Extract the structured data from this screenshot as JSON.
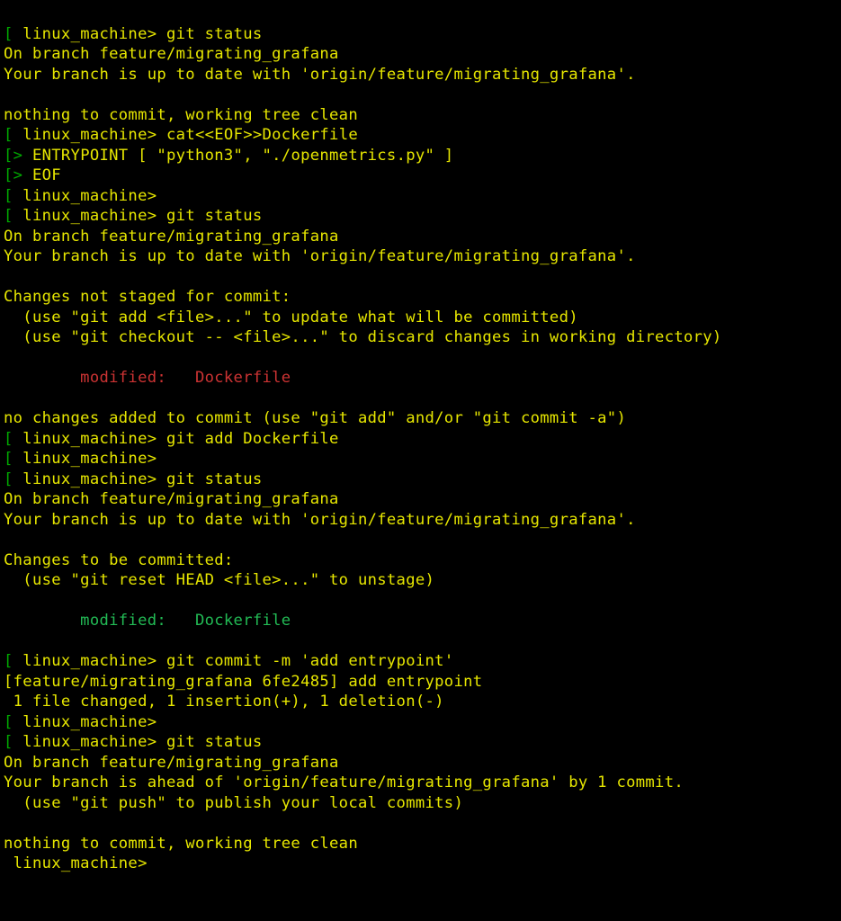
{
  "colors": {
    "bg": "#000000",
    "fg": "#e6e600",
    "bracket": "#00aa00",
    "red": "#cc3333",
    "green": "#22bb55"
  },
  "host": "linux_machine",
  "prompt_fmt": "[ {host}> ",
  "heredoc_prompt": "[> ",
  "branch": "feature/migrating_grafana",
  "remote": "origin/feature/migrating_grafana",
  "commit_hash": "6fe2485",
  "commit_msg": "add entrypoint",
  "file": "Dockerfile",
  "cmds": {
    "status": "git status",
    "cat": "cat<<EOF>>Dockerfile",
    "add": "git add Dockerfile",
    "commit": "git commit -m 'add entrypoint'"
  },
  "heredoc_lines": [
    "ENTRYPOINT [ \"python3\", \"./openmetrics.py\" ]",
    "EOF"
  ],
  "msgs": {
    "on_branch": "On branch feature/migrating_grafana",
    "uptodate": "Your branch is up to date with 'origin/feature/migrating_grafana'.",
    "nothing": "nothing to commit, working tree clean",
    "not_staged_hdr": "Changes not staged for commit:",
    "hint_add": "  (use \"git add <file>...\" to update what will be committed)",
    "hint_checkout": "  (use \"git checkout -- <file>...\" to discard changes in working directory)",
    "modified": "        modified:   Dockerfile",
    "no_changes_added": "no changes added to commit (use \"git add\" and/or \"git commit -a\")",
    "to_commit_hdr": "Changes to be committed:",
    "hint_reset": "  (use \"git reset HEAD <file>...\" to unstage)",
    "commit_out1": "[feature/migrating_grafana 6fe2485] add entrypoint",
    "commit_out2": " 1 file changed, 1 insertion(+), 1 deletion(-)",
    "ahead": "Your branch is ahead of 'origin/feature/migrating_grafana' by 1 commit.",
    "hint_push": "  (use \"git push\" to publish your local commits)"
  }
}
